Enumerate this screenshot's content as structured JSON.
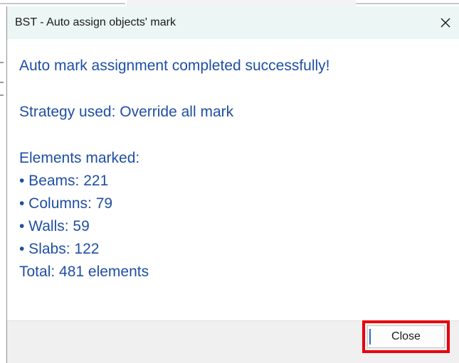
{
  "dialog": {
    "title": "BST - Auto assign objects' mark",
    "close_icon": "close-x-icon"
  },
  "message": {
    "success": "Auto mark assignment completed successfully!",
    "strategy": "Strategy used: Override all mark",
    "elements_header": "Elements marked:",
    "items": [
      "• Beams: 221",
      "• Columns: 79",
      "• Walls: 59",
      "• Slabs: 122"
    ],
    "total": "Total: 481 elements"
  },
  "footer": {
    "close_label": "Close"
  },
  "colors": {
    "message_text": "#1f4ea3",
    "titlebar_bg": "#ecf6f5",
    "highlight": "#e8000b"
  }
}
